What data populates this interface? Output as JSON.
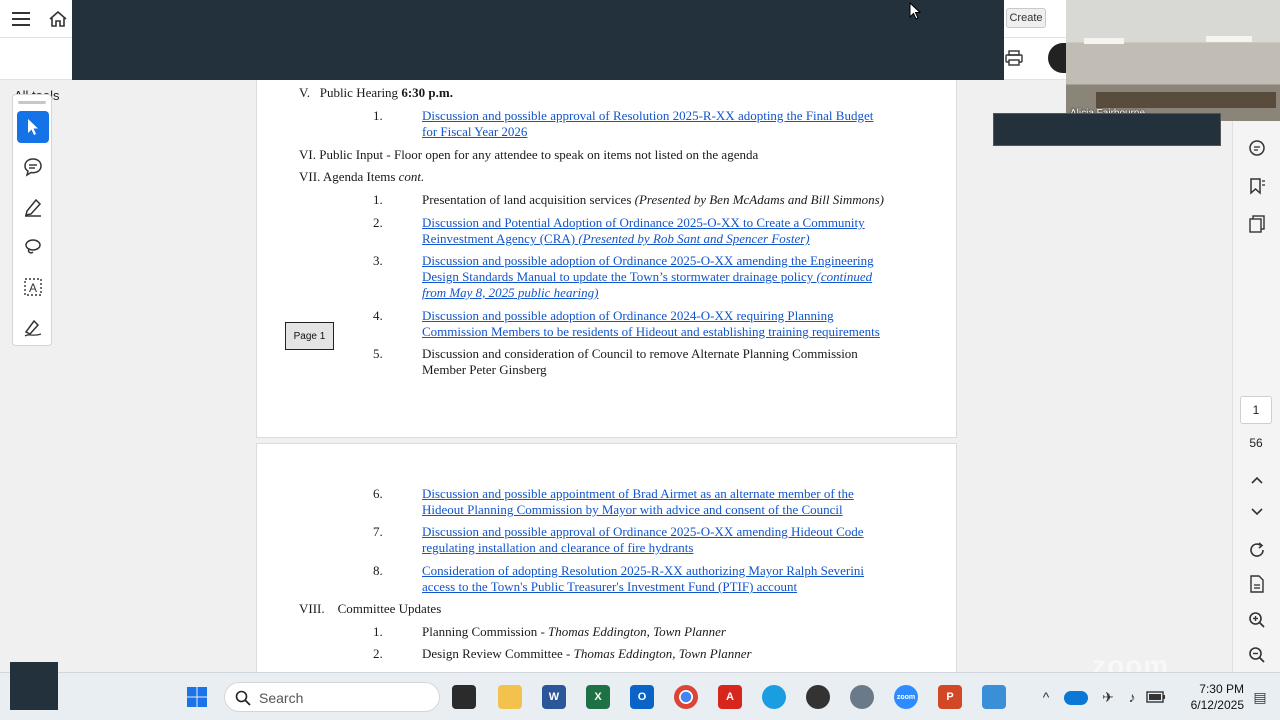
{
  "toolbar": {
    "create_label": "Create",
    "all_tools_label": "All tools"
  },
  "video": {
    "participant_name": "Alicia Fairbourne"
  },
  "navigation": {
    "current_page": "1",
    "total_pages": "56"
  },
  "page1": {
    "section_v": {
      "numeral": "V.",
      "title": "Public Hearing ",
      "time": "6:30 p.m."
    },
    "v1": {
      "num": "1.",
      "line1": "Discussion and possible approval of Resolution 2025-R-XX adopting the Final Budget",
      "line2": "for Fiscal Year 2026"
    },
    "section_vi": {
      "text": "VI.  Public Input - Floor open for any attendee to speak on items not listed on the agenda"
    },
    "section_vii": {
      "text": "VII. Agenda Items ",
      "cont": "cont."
    },
    "vii1": {
      "num": "1.",
      "text": "Presentation of land acquisition services ",
      "presenter": "(Presented by Ben McAdams and Bill Simmons)"
    },
    "vii2": {
      "num": "2.",
      "line1": "Discussion and Potential Adoption of Ordinance 2025-O-XX to Create a Community",
      "line2": "Reinvestment Agency (CRA) ",
      "presenter": "(Presented by Rob Sant and Spencer Foster)"
    },
    "vii3": {
      "num": "3.",
      "line1a": "Discussion and possible adoption of Ordinance 2025-O-XX amending the Engineering",
      "line2a": "Design Standards Manual to update the Town’s stormwater drainage policy ",
      "line2b": "(continued",
      "line3": "from May 8, 2025 public hearing)"
    },
    "vii4": {
      "num": "4.",
      "line1": "Discussion and possible adoption of Ordinance 2024-O-XX requiring Planning",
      "line2": "Commission Members to be residents of Hideout and establishing training requirements"
    },
    "vii5": {
      "num": "5.",
      "line1": "Discussion and consideration of Council to remove Alternate Planning Commission",
      "line2": "Member Peter Ginsberg"
    },
    "page_label": "Page 1"
  },
  "page2": {
    "vii6": {
      "num": "6.",
      "line1": "Discussion and possible appointment of Brad Airmet as an alternate member of the",
      "line2": "Hideout Planning Commission by Mayor with advice and consent of the Council"
    },
    "vii7": {
      "num": "7.",
      "line1": "Discussion and possible approval of Ordinance 2025-O-XX amending Hideout Code",
      "line2": "regulating installation and clearance of fire hydrants"
    },
    "vii8": {
      "num": "8.",
      "line1": "Consideration of adopting Resolution 2025-R-XX authorizing Mayor Ralph Severini",
      "line2": "access to the Town's Public Treasurer's Investment Fund (PTIF) account"
    },
    "section_viii": {
      "numeral": "VIII.",
      "title": "Committee Updates"
    },
    "viii1": {
      "num": "1.",
      "text": "Planning Commission - ",
      "person": "Thomas Eddington, Town Planner"
    },
    "viii2": {
      "num": "2.",
      "text": "Design Review Committee - ",
      "person": "Thomas Eddington, Town Planner"
    }
  },
  "taskbar": {
    "search_label": "Search",
    "time": "7:30 PM",
    "date": "6/12/2025",
    "watermark": "zoom"
  }
}
